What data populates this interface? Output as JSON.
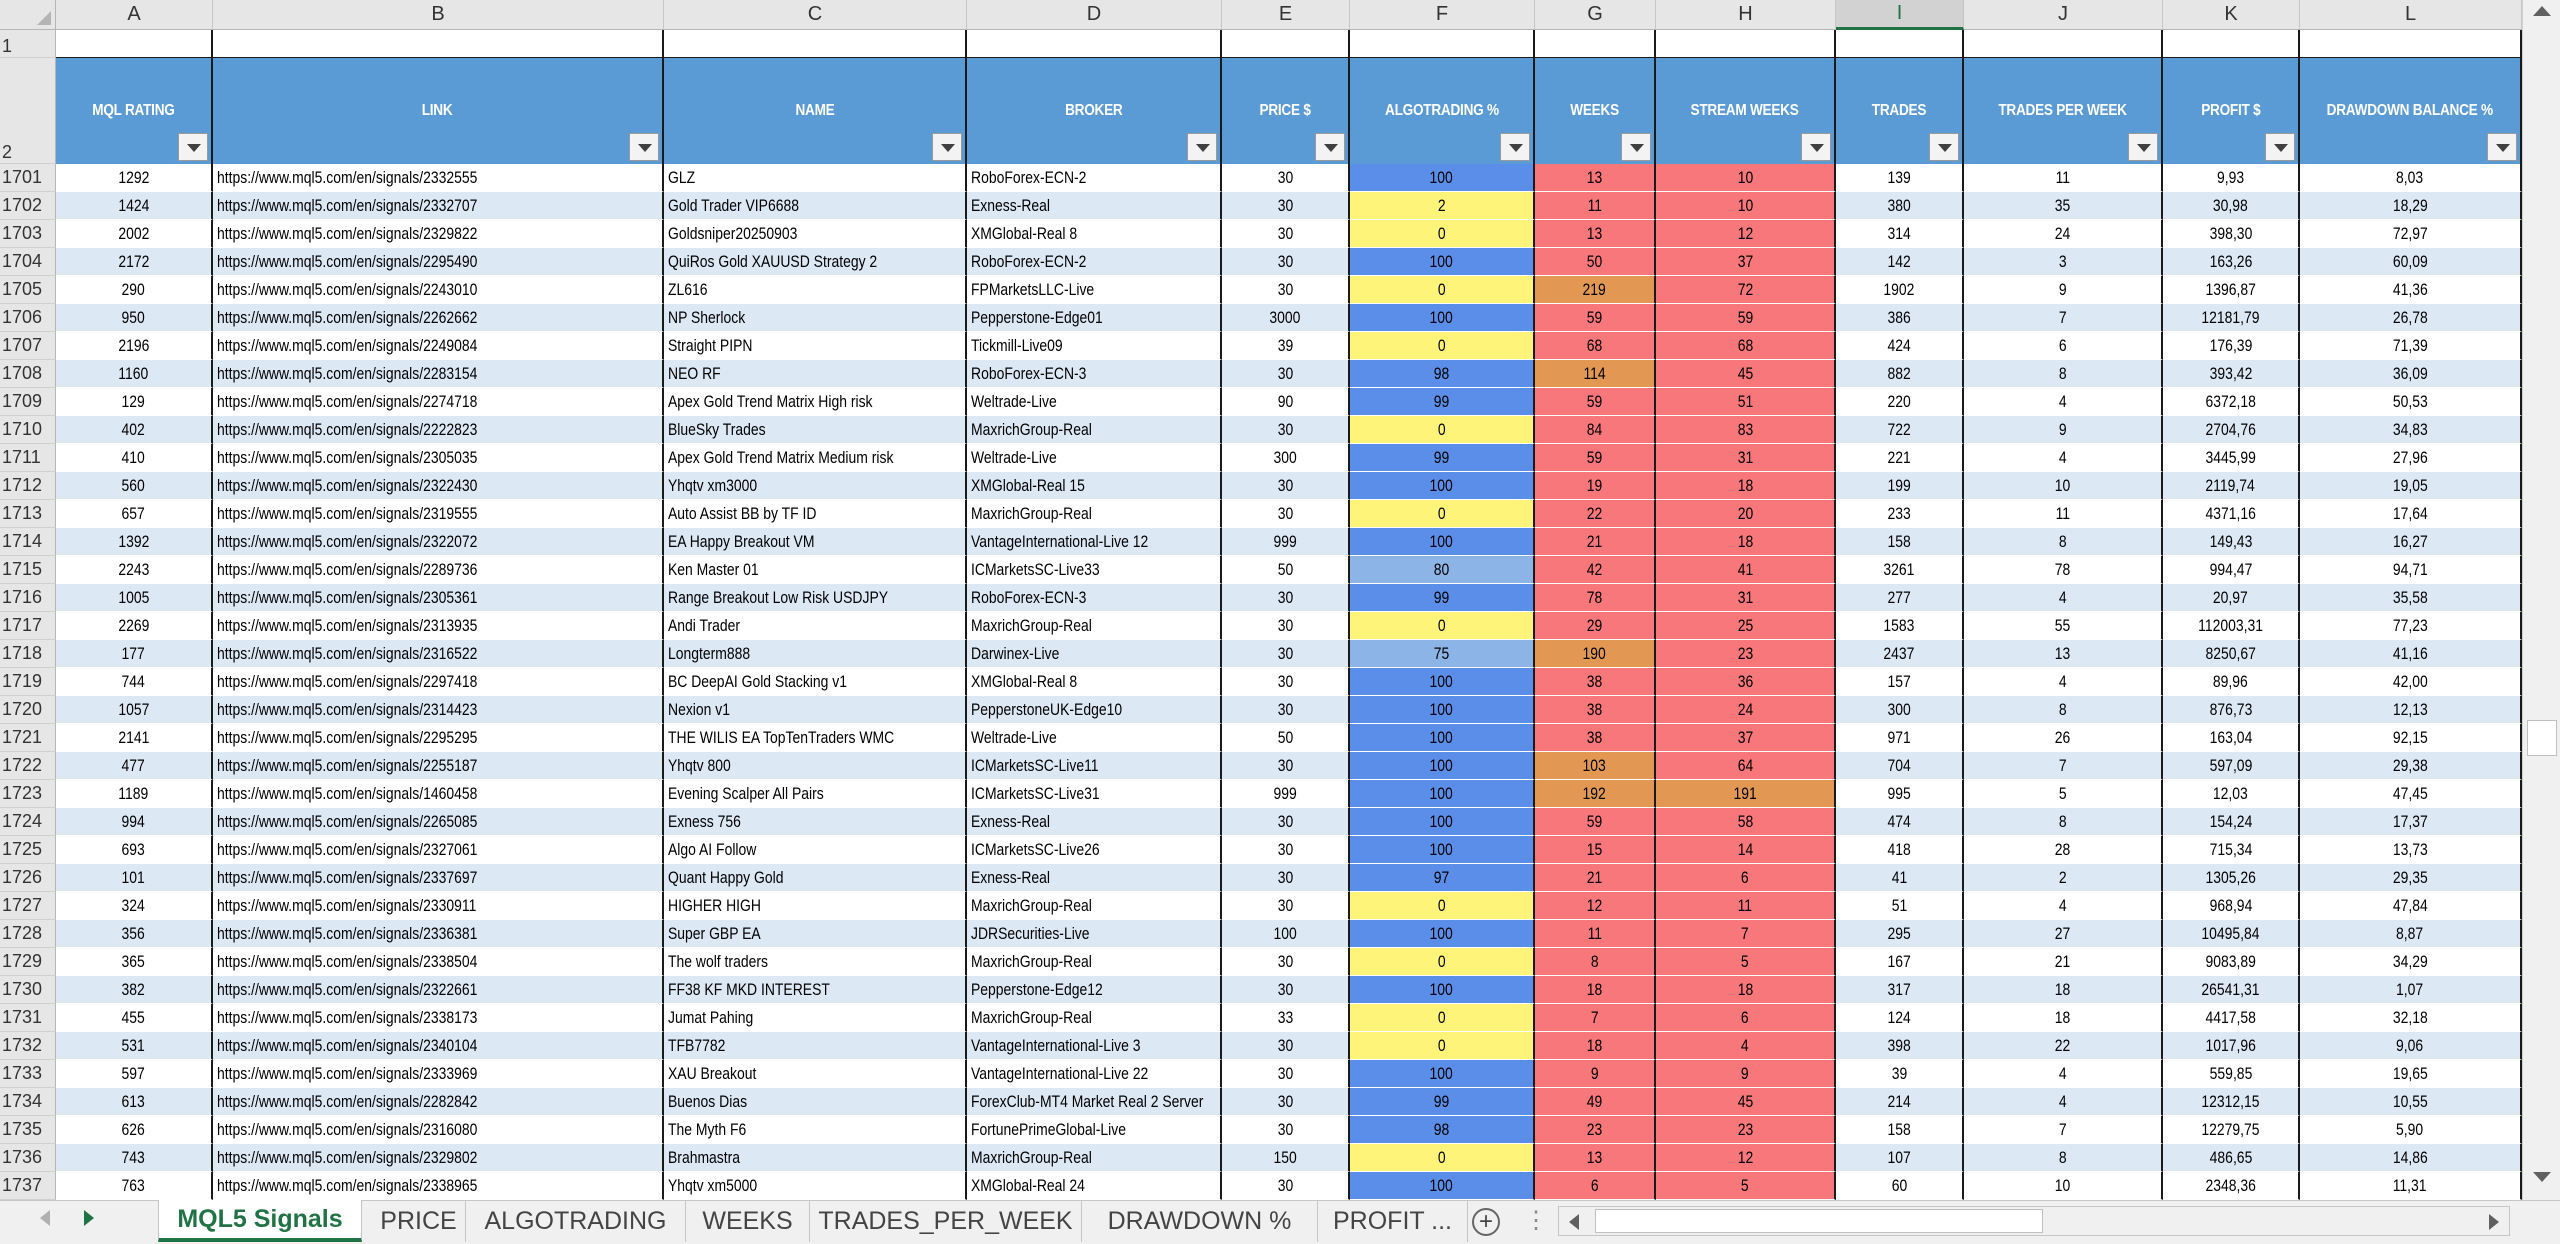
{
  "columns": [
    "A",
    "B",
    "C",
    "D",
    "E",
    "F",
    "G",
    "H",
    "I",
    "J",
    "K",
    "L"
  ],
  "selected_column": "I",
  "header_row_numbers": [
    "1",
    "2"
  ],
  "headers": [
    "MQL RATING",
    "LINK",
    "NAME",
    "BROKER",
    "PRICE $",
    "ALGOTRADING %",
    "WEEKS",
    "STREAM WEEKS",
    "TRADES",
    "TRADES PER WEEK",
    "PROFIT $",
    "DRAWDOWN BALANCE %"
  ],
  "colors": {
    "header_blue": "#5b9bd5",
    "row_light": "#dde8f5",
    "algo_blue": "#5a8ee8",
    "algo_mid": "#8db4e6",
    "algo_yellow": "#fff47a",
    "weeks_red": "#f8777a",
    "weeks_orange": "#e29852",
    "accent_green": "#217346"
  },
  "rows": [
    {
      "num": "1701",
      "cells": [
        "1292",
        "https://www.mql5.com/en/signals/2332555",
        "GLZ",
        "RoboForex-ECN-2",
        "30",
        "100",
        "13",
        "10",
        "139",
        "11",
        "9,93",
        "8,03"
      ]
    },
    {
      "num": "1702",
      "cells": [
        "1424",
        "https://www.mql5.com/en/signals/2332707",
        "Gold Trader VIP6688",
        "Exness-Real",
        "30",
        "2",
        "11",
        "10",
        "380",
        "35",
        "30,98",
        "18,29"
      ]
    },
    {
      "num": "1703",
      "cells": [
        "2002",
        "https://www.mql5.com/en/signals/2329822",
        "Goldsniper20250903",
        "XMGlobal-Real 8",
        "30",
        "0",
        "13",
        "12",
        "314",
        "24",
        "398,30",
        "72,97"
      ]
    },
    {
      "num": "1704",
      "cells": [
        "2172",
        "https://www.mql5.com/en/signals/2295490",
        "QuiRos Gold XAUUSD Strategy 2",
        "RoboForex-ECN-2",
        "30",
        "100",
        "50",
        "37",
        "142",
        "3",
        "163,26",
        "60,09"
      ]
    },
    {
      "num": "1705",
      "cells": [
        "290",
        "https://www.mql5.com/en/signals/2243010",
        "ZL616",
        "FPMarketsLLC-Live",
        "30",
        "0",
        "219",
        "72",
        "1902",
        "9",
        "1396,87",
        "41,36"
      ]
    },
    {
      "num": "1706",
      "cells": [
        "950",
        "https://www.mql5.com/en/signals/2262662",
        "NP Sherlock",
        "Pepperstone-Edge01",
        "3000",
        "100",
        "59",
        "59",
        "386",
        "7",
        "12181,79",
        "26,78"
      ]
    },
    {
      "num": "1707",
      "cells": [
        "2196",
        "https://www.mql5.com/en/signals/2249084",
        "Straight PIPN",
        "Tickmill-Live09",
        "39",
        "0",
        "68",
        "68",
        "424",
        "6",
        "176,39",
        "71,39"
      ]
    },
    {
      "num": "1708",
      "cells": [
        "1160",
        "https://www.mql5.com/en/signals/2283154",
        "NEO RF",
        "RoboForex-ECN-3",
        "30",
        "98",
        "114",
        "45",
        "882",
        "8",
        "393,42",
        "36,09"
      ]
    },
    {
      "num": "1709",
      "cells": [
        "129",
        "https://www.mql5.com/en/signals/2274718",
        "Apex Gold Trend Matrix High risk",
        "Weltrade-Live",
        "90",
        "99",
        "59",
        "51",
        "220",
        "4",
        "6372,18",
        "50,53"
      ]
    },
    {
      "num": "1710",
      "cells": [
        "402",
        "https://www.mql5.com/en/signals/2222823",
        "BlueSky Trades",
        "MaxrichGroup-Real",
        "30",
        "0",
        "84",
        "83",
        "722",
        "9",
        "2704,76",
        "34,83"
      ]
    },
    {
      "num": "1711",
      "cells": [
        "410",
        "https://www.mql5.com/en/signals/2305035",
        "Apex Gold Trend Matrix Medium risk",
        "Weltrade-Live",
        "300",
        "99",
        "59",
        "31",
        "221",
        "4",
        "3445,99",
        "27,96"
      ]
    },
    {
      "num": "1712",
      "cells": [
        "560",
        "https://www.mql5.com/en/signals/2322430",
        "Yhqtv xm3000",
        "XMGlobal-Real 15",
        "30",
        "100",
        "19",
        "18",
        "199",
        "10",
        "2119,74",
        "19,05"
      ]
    },
    {
      "num": "1713",
      "cells": [
        "657",
        "https://www.mql5.com/en/signals/2319555",
        "Auto Assist BB by TF ID",
        "MaxrichGroup-Real",
        "30",
        "0",
        "22",
        "20",
        "233",
        "11",
        "4371,16",
        "17,64"
      ]
    },
    {
      "num": "1714",
      "cells": [
        "1392",
        "https://www.mql5.com/en/signals/2322072",
        "EA Happy Breakout VM",
        "VantageInternational-Live 12",
        "999",
        "100",
        "21",
        "18",
        "158",
        "8",
        "149,43",
        "16,27"
      ]
    },
    {
      "num": "1715",
      "cells": [
        "2243",
        "https://www.mql5.com/en/signals/2289736",
        "Ken Master 01",
        "ICMarketsSC-Live33",
        "50",
        "80",
        "42",
        "41",
        "3261",
        "78",
        "994,47",
        "94,71"
      ]
    },
    {
      "num": "1716",
      "cells": [
        "1005",
        "https://www.mql5.com/en/signals/2305361",
        "Range Breakout Low Risk USDJPY",
        "RoboForex-ECN-3",
        "30",
        "99",
        "78",
        "31",
        "277",
        "4",
        "20,97",
        "35,58"
      ]
    },
    {
      "num": "1717",
      "cells": [
        "2269",
        "https://www.mql5.com/en/signals/2313935",
        "Andi Trader",
        "MaxrichGroup-Real",
        "30",
        "0",
        "29",
        "25",
        "1583",
        "55",
        "112003,31",
        "77,23"
      ]
    },
    {
      "num": "1718",
      "cells": [
        "177",
        "https://www.mql5.com/en/signals/2316522",
        "Longterm888",
        "Darwinex-Live",
        "30",
        "75",
        "190",
        "23",
        "2437",
        "13",
        "8250,67",
        "41,16"
      ]
    },
    {
      "num": "1719",
      "cells": [
        "744",
        "https://www.mql5.com/en/signals/2297418",
        "BC DeepAI Gold Stacking v1",
        "XMGlobal-Real 8",
        "30",
        "100",
        "38",
        "36",
        "157",
        "4",
        "89,96",
        "42,00"
      ]
    },
    {
      "num": "1720",
      "cells": [
        "1057",
        "https://www.mql5.com/en/signals/2314423",
        "Nexion v1",
        "PepperstoneUK-Edge10",
        "30",
        "100",
        "38",
        "24",
        "300",
        "8",
        "876,73",
        "12,13"
      ]
    },
    {
      "num": "1721",
      "cells": [
        "2141",
        "https://www.mql5.com/en/signals/2295295",
        "THE WILIS EA TopTenTraders WMC",
        "Weltrade-Live",
        "50",
        "100",
        "38",
        "37",
        "971",
        "26",
        "163,04",
        "92,15"
      ]
    },
    {
      "num": "1722",
      "cells": [
        "477",
        "https://www.mql5.com/en/signals/2255187",
        "Yhqtv 800",
        "ICMarketsSC-Live11",
        "30",
        "100",
        "103",
        "64",
        "704",
        "7",
        "597,09",
        "29,38"
      ]
    },
    {
      "num": "1723",
      "cells": [
        "1189",
        "https://www.mql5.com/en/signals/1460458",
        "Evening Scalper All Pairs",
        "ICMarketsSC-Live31",
        "999",
        "100",
        "192",
        "191",
        "995",
        "5",
        "12,03",
        "47,45"
      ]
    },
    {
      "num": "1724",
      "cells": [
        "994",
        "https://www.mql5.com/en/signals/2265085",
        "Exness 756",
        "Exness-Real",
        "30",
        "100",
        "59",
        "58",
        "474",
        "8",
        "154,24",
        "17,37"
      ]
    },
    {
      "num": "1725",
      "cells": [
        "693",
        "https://www.mql5.com/en/signals/2327061",
        "Algo AI Follow",
        "ICMarketsSC-Live26",
        "30",
        "100",
        "15",
        "14",
        "418",
        "28",
        "715,34",
        "13,73"
      ]
    },
    {
      "num": "1726",
      "cells": [
        "101",
        "https://www.mql5.com/en/signals/2337697",
        "Quant Happy Gold",
        "Exness-Real",
        "30",
        "97",
        "21",
        "6",
        "41",
        "2",
        "1305,26",
        "29,35"
      ]
    },
    {
      "num": "1727",
      "cells": [
        "324",
        "https://www.mql5.com/en/signals/2330911",
        "HIGHER HIGH",
        "MaxrichGroup-Real",
        "30",
        "0",
        "12",
        "11",
        "51",
        "4",
        "968,94",
        "47,84"
      ]
    },
    {
      "num": "1728",
      "cells": [
        "356",
        "https://www.mql5.com/en/signals/2336381",
        "Super GBP EA",
        "JDRSecurities-Live",
        "100",
        "100",
        "11",
        "7",
        "295",
        "27",
        "10495,84",
        "8,87"
      ]
    },
    {
      "num": "1729",
      "cells": [
        "365",
        "https://www.mql5.com/en/signals/2338504",
        "The wolf traders",
        "MaxrichGroup-Real",
        "30",
        "0",
        "8",
        "5",
        "167",
        "21",
        "9083,89",
        "34,29"
      ]
    },
    {
      "num": "1730",
      "cells": [
        "382",
        "https://www.mql5.com/en/signals/2322661",
        "FF38 KF MKD INTEREST",
        "Pepperstone-Edge12",
        "30",
        "100",
        "18",
        "18",
        "317",
        "18",
        "26541,31",
        "1,07"
      ]
    },
    {
      "num": "1731",
      "cells": [
        "455",
        "https://www.mql5.com/en/signals/2338173",
        "Jumat Pahing",
        "MaxrichGroup-Real",
        "33",
        "0",
        "7",
        "6",
        "124",
        "18",
        "4417,58",
        "32,18"
      ]
    },
    {
      "num": "1732",
      "cells": [
        "531",
        "https://www.mql5.com/en/signals/2340104",
        "TFB7782",
        "VantageInternational-Live 3",
        "30",
        "0",
        "18",
        "4",
        "398",
        "22",
        "1017,96",
        "9,06"
      ]
    },
    {
      "num": "1733",
      "cells": [
        "597",
        "https://www.mql5.com/en/signals/2333969",
        "XAU Breakout",
        "VantageInternational-Live 22",
        "30",
        "100",
        "9",
        "9",
        "39",
        "4",
        "559,85",
        "19,65"
      ]
    },
    {
      "num": "1734",
      "cells": [
        "613",
        "https://www.mql5.com/en/signals/2282842",
        "Buenos Dias",
        "ForexClub-MT4 Market Real 2 Server",
        "30",
        "99",
        "49",
        "45",
        "214",
        "4",
        "12312,15",
        "10,55"
      ]
    },
    {
      "num": "1735",
      "cells": [
        "626",
        "https://www.mql5.com/en/signals/2316080",
        "The Myth F6",
        "FortunePrimeGlobal-Live",
        "30",
        "98",
        "23",
        "23",
        "158",
        "7",
        "12279,75",
        "5,90"
      ]
    },
    {
      "num": "1736",
      "cells": [
        "743",
        "https://www.mql5.com/en/signals/2329802",
        "Brahmastra",
        "MaxrichGroup-Real",
        "150",
        "0",
        "13",
        "12",
        "107",
        "8",
        "486,65",
        "14,86"
      ]
    },
    {
      "num": "1737",
      "cells": [
        "763",
        "https://www.mql5.com/en/signals/2338965",
        "Yhqtv xm5000",
        "XMGlobal-Real 24",
        "30",
        "100",
        "6",
        "5",
        "60",
        "10",
        "2348,36",
        "11,31"
      ]
    }
  ],
  "tabs": [
    {
      "label": "MQL5 Signals",
      "active": true
    },
    {
      "label": "PRICE",
      "active": false
    },
    {
      "label": "ALGOTRADING",
      "active": false
    },
    {
      "label": "WEEKS",
      "active": false
    },
    {
      "label": "TRADES_PER_WEEK",
      "active": false
    },
    {
      "label": "DRAWDOWN %",
      "active": false
    },
    {
      "label": "PROFIT ...",
      "active": false
    }
  ],
  "icons": {
    "add_sheet": "plus-circle-icon",
    "tab_options": "more-dots-icon",
    "tab_nav_prev": "triangle-left-icon",
    "tab_nav_next": "triangle-right-icon"
  },
  "add_sheet_symbol": "+",
  "tab_options_symbol": "⋮"
}
